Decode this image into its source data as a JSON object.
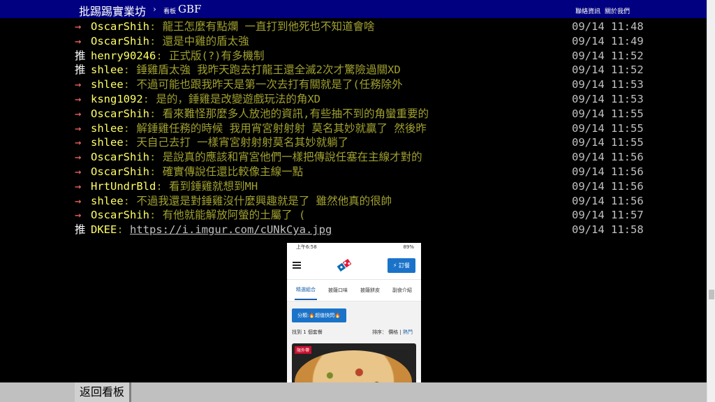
{
  "topbar": {
    "brand": "批踢踢實業坊",
    "separator": "›",
    "board_label": "看板",
    "board_name": "GBF",
    "links": [
      "聯絡資訊",
      "關於我們"
    ]
  },
  "pushes": [
    {
      "tag": "→",
      "kind": "arrow",
      "user": "OscarShih",
      "content": ": 龍王怎麼有點爛 一直打到他死也不知道會啥",
      "time": "09/14 11:48"
    },
    {
      "tag": "→",
      "kind": "arrow",
      "user": "OscarShih",
      "content": ": 還是中雞的盾太強",
      "time": "09/14 11:49"
    },
    {
      "tag": "推",
      "kind": "push",
      "user": "henry90246",
      "content": ": 正式版(?)有多機制",
      "time": "09/14 11:52"
    },
    {
      "tag": "推",
      "kind": "push",
      "user": "shlee",
      "content": ": 錘雞盾太強  我昨天跑去打龍王還全滅2次才驚險過關XD",
      "time": "09/14 11:52"
    },
    {
      "tag": "→",
      "kind": "arrow",
      "user": "shlee",
      "content": ": 不過可能也跟我昨天是第一次去打有關就是了(任務除外",
      "time": "09/14 11:53"
    },
    {
      "tag": "→",
      "kind": "arrow",
      "user": "ksng1092",
      "content": ": 是的，錘雞是改變遊戲玩法的角XD",
      "time": "09/14 11:53"
    },
    {
      "tag": "→",
      "kind": "arrow",
      "user": "OscarShih",
      "content": ": 看來難怪那麼多人放池的資訊,有些抽不到的角蠻重要的",
      "time": "09/14 11:55"
    },
    {
      "tag": "→",
      "kind": "arrow",
      "user": "shlee",
      "content": ": 解錘雞任務的時候 我用宵宮射射射 莫名其妙就贏了 然後昨",
      "time": "09/14 11:55"
    },
    {
      "tag": "→",
      "kind": "arrow",
      "user": "shlee",
      "content": ": 天自己去打 一樣宵宮射射射莫名其妙就躺了",
      "time": "09/14 11:55"
    },
    {
      "tag": "→",
      "kind": "arrow",
      "user": "OscarShih",
      "content": ": 是說真的應該和宵宮他們一樣把傳說任塞在主線才對的",
      "time": "09/14 11:56"
    },
    {
      "tag": "→",
      "kind": "arrow",
      "user": "OscarShih",
      "content": ": 確實傳說任還比較像主線一點",
      "time": "09/14 11:56"
    },
    {
      "tag": "→",
      "kind": "arrow",
      "user": "HrtUndrBld",
      "content": ": 看到錘雞就想到MH",
      "time": "09/14 11:56"
    },
    {
      "tag": "→",
      "kind": "arrow",
      "user": "shlee",
      "content": ": 不過我還是對錘雞沒什麼興趣就是了 雖然他真的很帥",
      "time": "09/14 11:56"
    },
    {
      "tag": "→",
      "kind": "arrow",
      "user": "OscarShih",
      "content": ": 有他就能解放阿螢的土屬了 (",
      "time": "09/14 11:57"
    },
    {
      "tag": "推",
      "kind": "push",
      "user": "DKEE",
      "content": ": ",
      "link": "https://i.imgur.com/cUNkCya.jpg",
      "time": "09/14 11:58"
    }
  ],
  "embedded": {
    "status_time": "上午6:58",
    "battery": "89%",
    "order_button": "⚡ 訂餐",
    "tabs": [
      "精選組合",
      "披薩口味",
      "披薩餅皮",
      "副食介紹"
    ],
    "active_tab": 0,
    "category_button": "分類:🔥超值快閃🔥",
    "found_text": "找到 1 個套餐",
    "sort_label": "排序：",
    "sort_price": "價格",
    "sort_sep": "|",
    "sort_hot": "熱門",
    "badge": "限外帶"
  },
  "bottombar": {
    "back_label": "返回看板"
  }
}
